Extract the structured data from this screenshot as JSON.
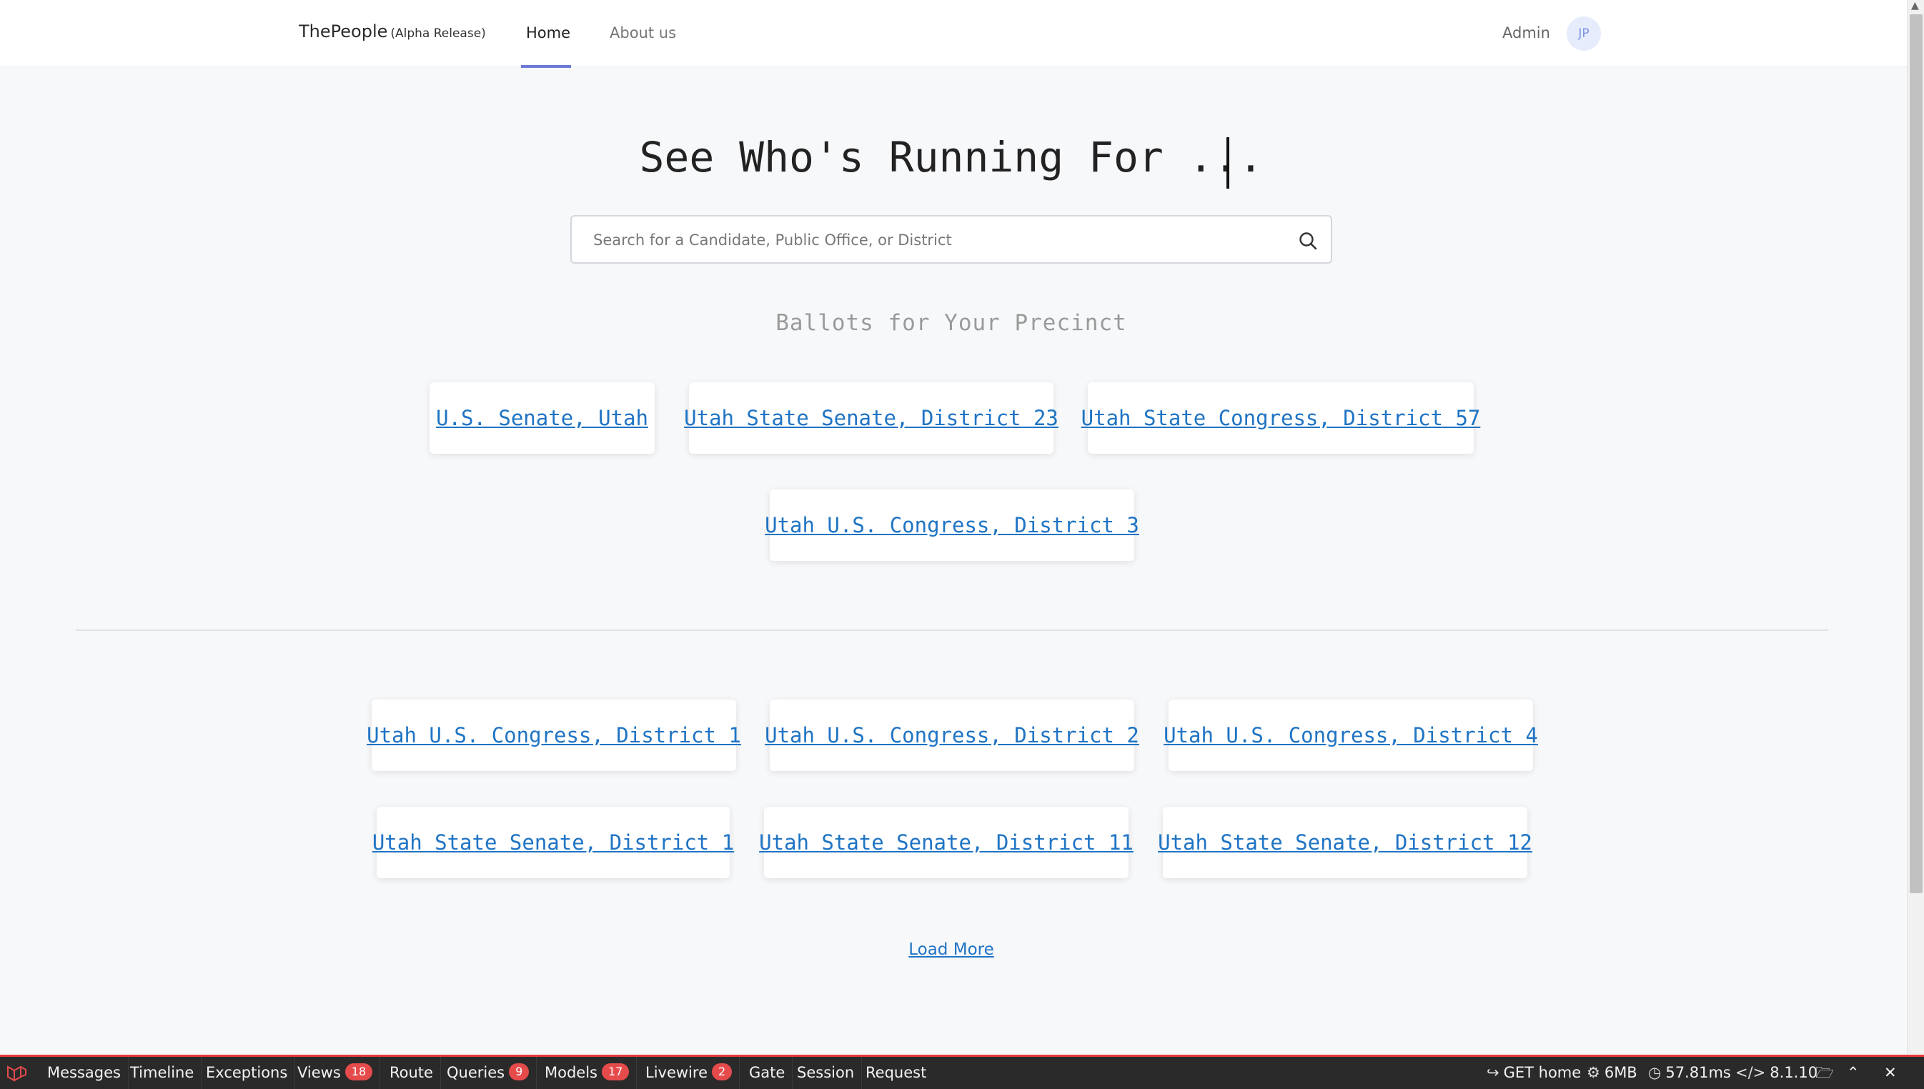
{
  "nav": {
    "brand": "ThePeople",
    "brand_sub": "(Alpha Release)",
    "tabs": [
      {
        "label": "Home",
        "active": true
      },
      {
        "label": "About us",
        "active": false
      }
    ],
    "admin_label": "Admin",
    "avatar_initials": "JP"
  },
  "hero": {
    "title": "See Who's Running For ...",
    "search_placeholder": "Search for a Candidate, Public Office, or District",
    "search_value": ""
  },
  "precinct": {
    "title": "Ballots for Your Precinct",
    "ballots": [
      "U.S. Senate, Utah",
      "Utah State Senate, District 23",
      "Utah State Congress, District 57",
      "Utah U.S. Congress, District 3"
    ]
  },
  "other_ballots": [
    "Utah U.S. Congress, District 1",
    "Utah U.S. Congress, District 2",
    "Utah U.S. Congress, District 4",
    "Utah State Senate, District 1",
    "Utah State Senate, District 11",
    "Utah State Senate, District 12"
  ],
  "load_more": "Load More",
  "debugbar": {
    "tabs": [
      {
        "label": "Messages",
        "badge": null
      },
      {
        "label": "Timeline",
        "badge": null
      },
      {
        "label": "Exceptions",
        "badge": null
      },
      {
        "label": "Views",
        "badge": "18"
      },
      {
        "label": "Route",
        "badge": null
      },
      {
        "label": "Queries",
        "badge": "9"
      },
      {
        "label": "Models",
        "badge": "17"
      },
      {
        "label": "Livewire",
        "badge": "2"
      },
      {
        "label": "Gate",
        "badge": null
      },
      {
        "label": "Session",
        "badge": null
      },
      {
        "label": "Request",
        "badge": null
      }
    ],
    "request": "GET home",
    "memory": "6MB",
    "time": "57.81ms",
    "php_version": "8.1.10"
  },
  "colors": {
    "link": "#1f74c4",
    "tab_underline": "#6b7bd6",
    "badge": "#e54b4b",
    "debug_border": "#e53b3b"
  }
}
